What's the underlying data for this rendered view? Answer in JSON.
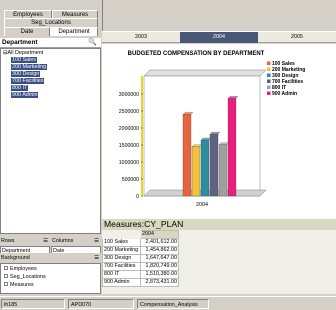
{
  "tabs": {
    "employees": "Employees",
    "measures": "Measures",
    "seg_locations": "Seg_Locations",
    "date": "Date",
    "department": "Department"
  },
  "department_panel": {
    "title": "Department",
    "root": "All Department",
    "items": [
      "100 Sales",
      "200 Marketing",
      "300 Design",
      "700 Facilities",
      "800 IT",
      "900 Admin"
    ]
  },
  "rows_label": "Rows",
  "columns_label": "Columns",
  "rows_value": "Department",
  "columns_value": "Date",
  "background_label": "Background",
  "background_items": [
    "Employees",
    "Seg_Locations",
    "Measures"
  ],
  "years": [
    "2003",
    "2004",
    "2005"
  ],
  "selected_year": "2004",
  "chart_data": {
    "type": "bar",
    "title": "BUDGETED COMPENSATION BY DEPARTMENT",
    "categories": [
      "2004"
    ],
    "series": [
      {
        "name": "100 Sales",
        "values": [
          2401612
        ],
        "color": "#e8643c"
      },
      {
        "name": "200 Marketing",
        "values": [
          1454862
        ],
        "color": "#f0c040"
      },
      {
        "name": "300 Design",
        "values": [
          1647647
        ],
        "color": "#2a8ea0"
      },
      {
        "name": "700 Facilities",
        "values": [
          1820749
        ],
        "color": "#606080"
      },
      {
        "name": "800 IT",
        "values": [
          1510380
        ],
        "color": "#a0a0a0"
      },
      {
        "name": "900 Admin",
        "values": [
          2873431
        ],
        "color": "#e8207c"
      }
    ],
    "ylim": [
      0,
      3000000
    ],
    "yticks": [
      "3000000",
      "2500000",
      "2000000",
      "1500000",
      "1000000",
      "500000",
      "0"
    ],
    "legend": "right",
    "grid": false
  },
  "measures_title": "Measures:CY_PLAN",
  "table": {
    "header": "2004",
    "rows": [
      {
        "label": "100 Sales",
        "value": "2,401,612.00"
      },
      {
        "label": "200 Marketing",
        "value": "1,454,862.00"
      },
      {
        "label": "300 Design",
        "value": "1,647,647.00"
      },
      {
        "label": "700 Facilities",
        "value": "1,820,749.00"
      },
      {
        "label": "800 IT",
        "value": "1,510,380.00"
      },
      {
        "label": "900 Admin",
        "value": "2,873,431.00"
      }
    ]
  },
  "status": {
    "host": "ih185",
    "db": "APD070",
    "report": "Compensation_Analysis"
  }
}
